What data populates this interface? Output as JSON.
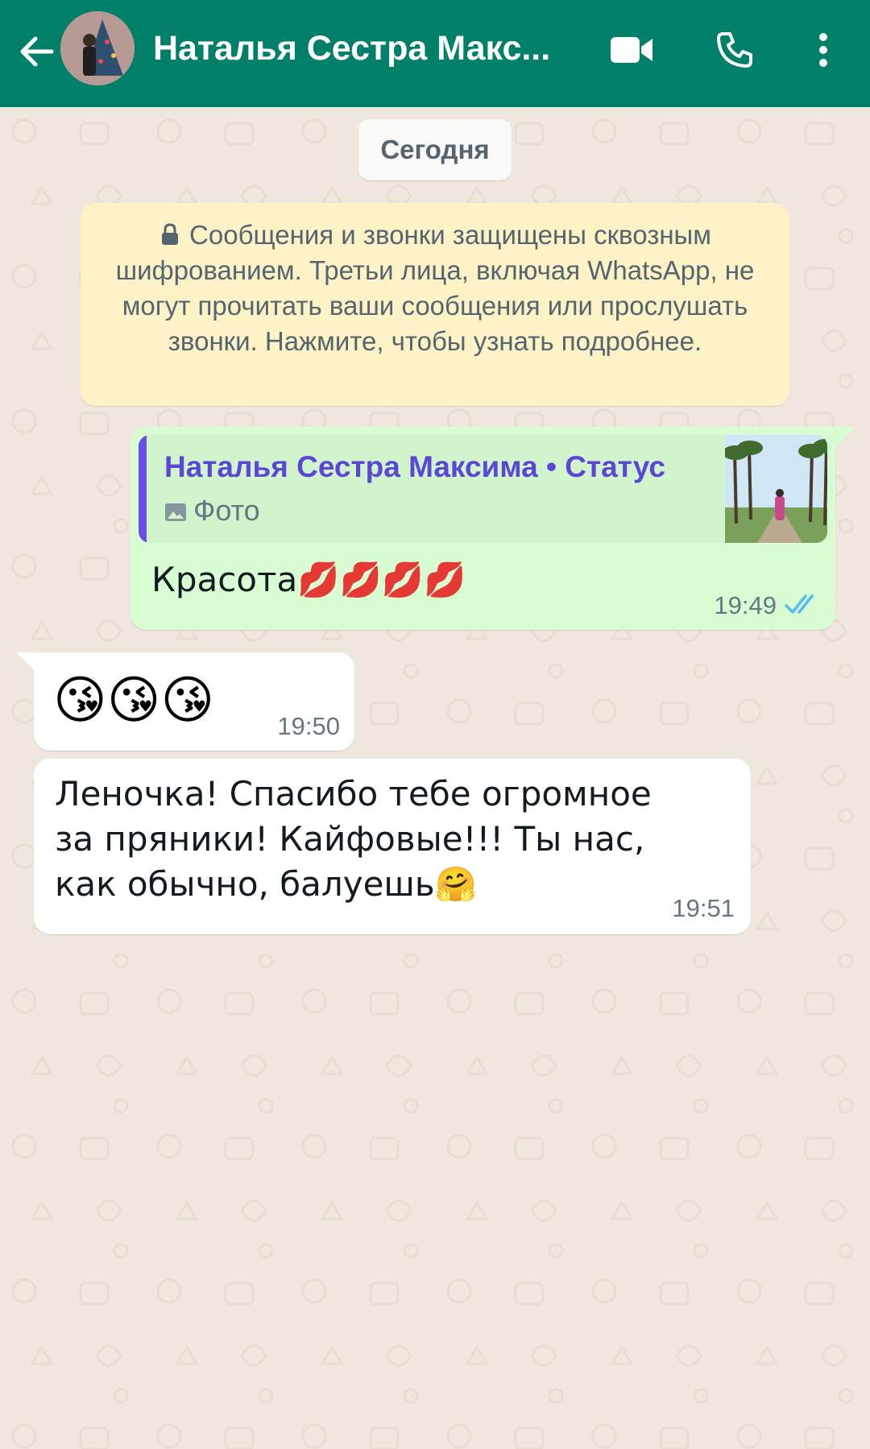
{
  "header": {
    "contact_name": "Наталья Сестра Макс...",
    "icons": [
      "back-arrow-icon",
      "video-call-icon",
      "voice-call-icon",
      "more-options-icon"
    ]
  },
  "chat": {
    "date_chip": "Сегодня",
    "encryption_notice": "Сообщения и звонки защищены сквозным шифрованием. Третьи лица, включая WhatsApp, не могут прочитать ваши сообщения или прослушать звонки. Нажмите, чтобы узнать подробнее.",
    "messages": [
      {
        "direction": "outgoing",
        "quote_title": "Наталья Сестра Максима • Статус",
        "quote_type": "Фото",
        "text": "Красота💋💋💋💋",
        "time": "19:49",
        "status": "read"
      },
      {
        "direction": "incoming",
        "text": "😘😘😘",
        "time": "19:50"
      },
      {
        "direction": "incoming",
        "text": "Леночка! Спасибо тебе огромное за пряники! Кайфовые!!! Ты нас, как обычно, балуешь🤗",
        "time": "19:51"
      }
    ]
  },
  "colors": {
    "header": "#008069",
    "chat_bg": "#efe7de",
    "outgoing_bubble": "#d9fdd3",
    "incoming_bubble": "#ffffff",
    "notice_bg": "#fdf2c6",
    "quote_accent": "#6b4ee6",
    "read_ticks": "#53bdeb"
  }
}
